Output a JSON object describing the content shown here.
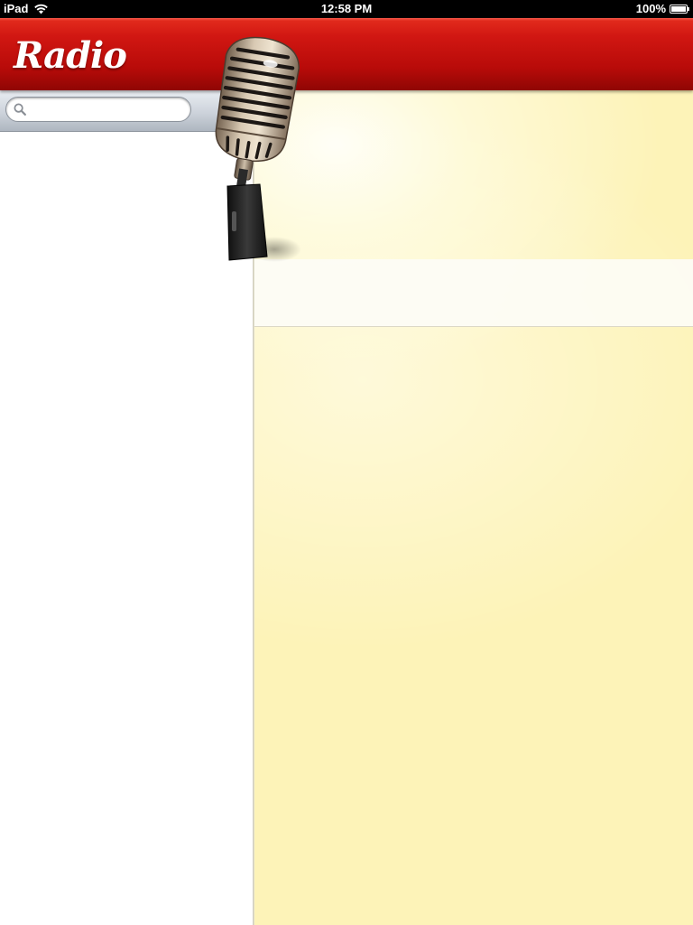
{
  "status_bar": {
    "carrier": "iPad",
    "time": "12:58 PM",
    "battery": "100%"
  },
  "header": {
    "title": "Radio"
  },
  "search": {
    "placeholder": "",
    "value": ""
  },
  "colors": {
    "header_red": "#d11712",
    "detail_background": "#fdf3b8",
    "sidebar_background": "#ffffff"
  },
  "icons": {
    "wifi": "wifi-icon",
    "battery": "battery-icon",
    "search": "search-icon",
    "microphone": "microphone-icon"
  }
}
